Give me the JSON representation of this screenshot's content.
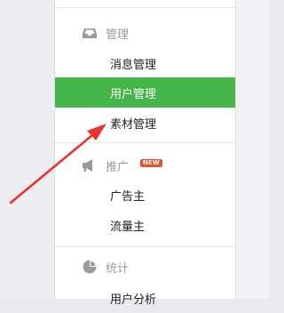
{
  "sidebar": {
    "sections": [
      {
        "title": "管理",
        "icon": "inbox-icon",
        "items": [
          "消息管理",
          "用户管理",
          "素材管理"
        ]
      },
      {
        "title": "推广",
        "icon": "megaphone-icon",
        "badge": "NEW",
        "items": [
          "广告主",
          "流量主"
        ]
      },
      {
        "title": "统计",
        "icon": "pie-chart-icon",
        "items": [
          "用户分析"
        ]
      }
    ],
    "active_item": "用户管理"
  },
  "colors": {
    "accent": "#44b549",
    "badge": "#e5532d",
    "annotation_arrow": "#e8322d"
  },
  "annotation": {
    "type": "arrow",
    "points_to": "素材管理"
  }
}
